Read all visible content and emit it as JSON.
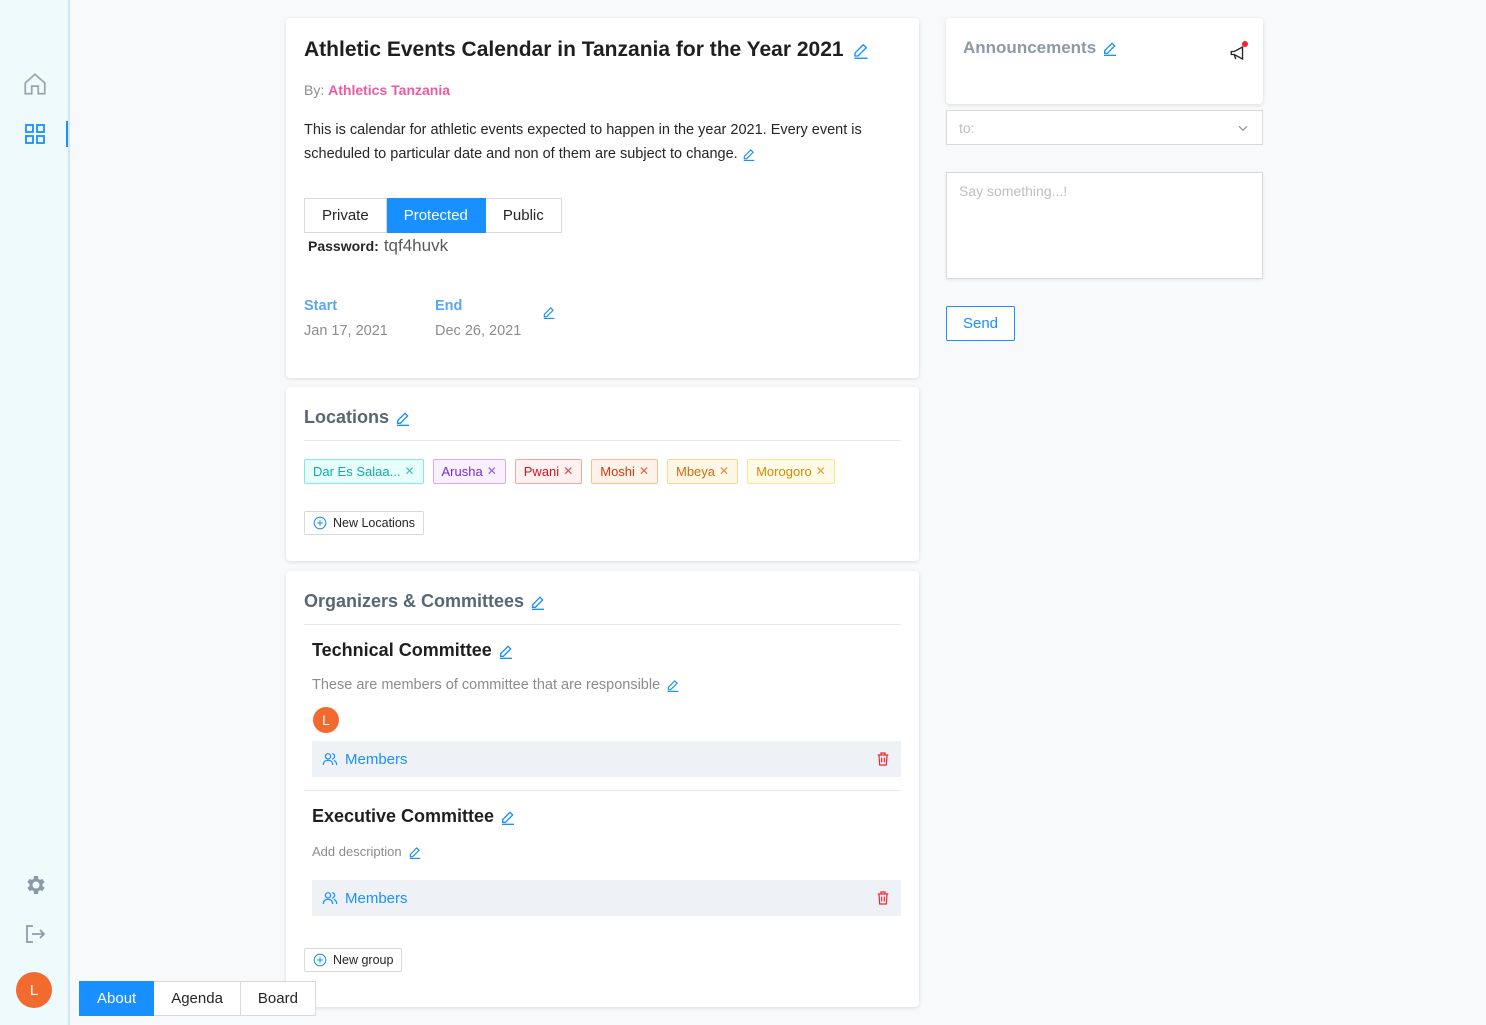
{
  "sidebar": {
    "avatar_initial": "L"
  },
  "event": {
    "title": "Athletic Events Calendar in Tanzania for the Year 2021",
    "by_label": "By:",
    "by_name": "Athletics Tanzania",
    "description": "This is calendar for athletic events expected to happen in the year 2021. Every event is scheduled to particular date and non of them are subject to change.",
    "privacy_options": [
      "Private",
      "Protected",
      "Public"
    ],
    "privacy_selected": "Protected",
    "password_label": "Password:",
    "password_value": "tqf4huvk",
    "start_label": "Start",
    "start_value": "Jan 17, 2021",
    "end_label": "End",
    "end_value": "Dec 26, 2021"
  },
  "locations": {
    "title": "Locations",
    "tags": [
      {
        "label": "Dar Es Salaa...",
        "color": "cyan"
      },
      {
        "label": "Arusha",
        "color": "purple"
      },
      {
        "label": "Pwani",
        "color": "red"
      },
      {
        "label": "Moshi",
        "color": "volcano"
      },
      {
        "label": "Mbeya",
        "color": "orange"
      },
      {
        "label": "Morogoro",
        "color": "gold"
      }
    ],
    "new_button": "New Locations"
  },
  "organizers": {
    "title": "Organizers & Committees",
    "committees": [
      {
        "name": "Technical Committee",
        "description": "These are members of committee that are responsible",
        "member_initials": [
          "L"
        ],
        "members_label": "Members"
      },
      {
        "name": "Executive Committee",
        "description": "Add description",
        "members_label": "Members"
      }
    ],
    "new_group_button": "New group"
  },
  "announcements": {
    "title": "Announcements",
    "to_placeholder": "to:",
    "message_placeholder": "Say something...!",
    "send_label": "Send"
  },
  "bottom_tabs": [
    "About",
    "Agenda",
    "Board"
  ],
  "bottom_tab_selected": "About",
  "colors": {
    "primary": "#1890ff",
    "author": "#eb5aa2",
    "avatar": "#f26a2e",
    "delete": "#f5222d",
    "notification_dot": "#f5222d"
  }
}
